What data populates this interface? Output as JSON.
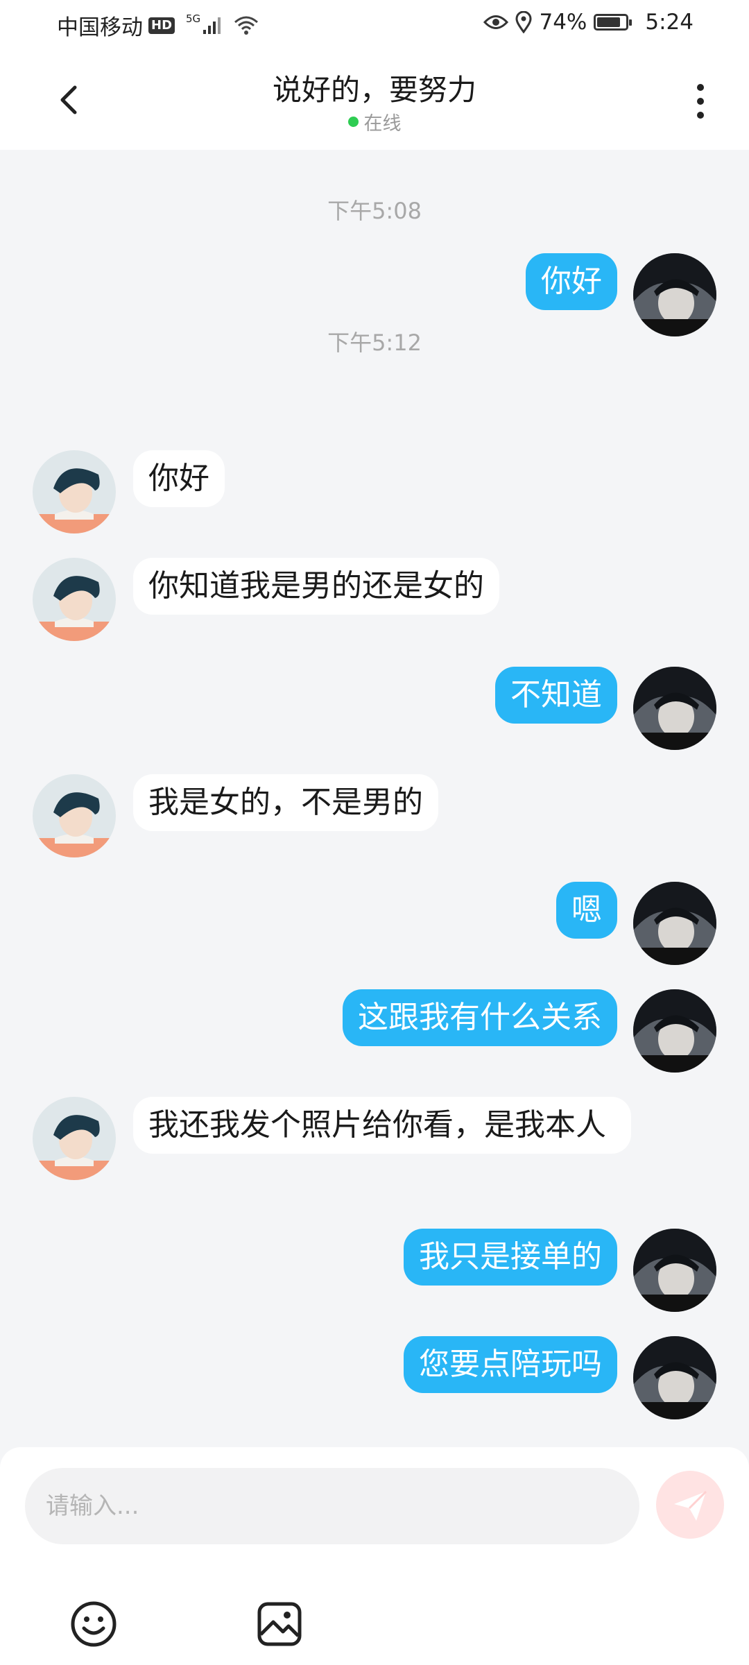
{
  "status_bar": {
    "carrier": "中国移动",
    "hd": "HD",
    "network": "5G",
    "battery": "74%",
    "battery_level": 0.74,
    "time": "5:24"
  },
  "header": {
    "title": "说好的，要努力",
    "status": "在线"
  },
  "chat": {
    "timestamps": [
      "下午5:08",
      "下午5:12"
    ],
    "messages": [
      {
        "from": "me",
        "text": "你好"
      },
      {
        "from": "them",
        "text": "你好"
      },
      {
        "from": "them",
        "text": "你知道我是男的还是女的"
      },
      {
        "from": "me",
        "text": "不知道"
      },
      {
        "from": "them",
        "text": "我是女的，不是男的"
      },
      {
        "from": "me",
        "text": "嗯"
      },
      {
        "from": "me",
        "text": "这跟我有什么关系"
      },
      {
        "from": "them",
        "text": "我还我发个照片给你看，是我本人"
      },
      {
        "from": "me",
        "text": "我只是接单的"
      },
      {
        "from": "me",
        "text": "您要点陪玩吗"
      }
    ]
  },
  "input": {
    "placeholder": "请输入..."
  },
  "icons": {
    "back": "chevron-left-icon",
    "more": "more-vertical-icon",
    "send": "send-icon",
    "emoji": "emoji-icon",
    "image": "image-icon"
  },
  "colors": {
    "my_bubble": "#29b6f6",
    "their_bubble": "#ffffff",
    "online": "#2ecc52",
    "send_button": "#ffe3e3"
  }
}
